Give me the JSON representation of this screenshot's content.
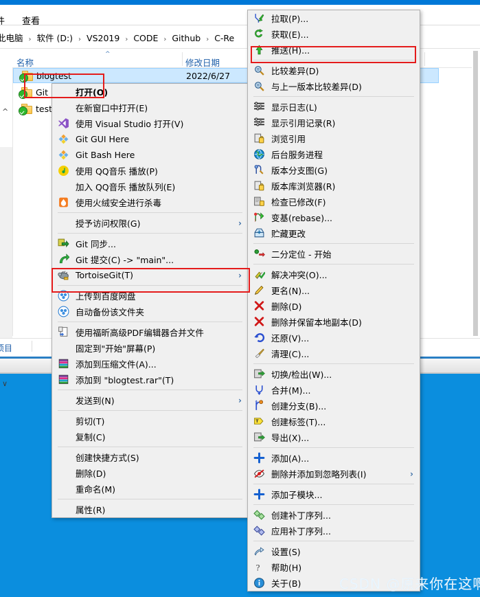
{
  "window": {
    "ribbon_tabs": [
      "件",
      "查看"
    ],
    "breadcrumb": [
      "此电脑",
      "软件 (D:)",
      "VS2019",
      "CODE",
      "Github",
      "C-Re"
    ],
    "breadcrumb_sep": "›",
    "columns": {
      "name": "名称",
      "date": "修改日期"
    },
    "status": "项目",
    "files": [
      {
        "name": "blogtest",
        "date": "2022/6/27",
        "icon": "folder-git-icon",
        "selected": true
      },
      {
        "name": "Git",
        "date": "",
        "icon": "folder-git-icon",
        "selected": false
      },
      {
        "name": "test",
        "date": "",
        "icon": "folder-git-icon",
        "selected": false
      }
    ]
  },
  "context_menu": {
    "name": "explorer-context-menu",
    "items": [
      {
        "label": "打开(O)",
        "icon": null,
        "bold": true,
        "type": "item"
      },
      {
        "label": "在新窗口中打开(E)",
        "icon": null,
        "type": "item"
      },
      {
        "label": "使用 Visual Studio 打开(V)",
        "icon": "visual-studio-icon",
        "type": "item"
      },
      {
        "label": "Git GUI Here",
        "icon": "git-gui-icon",
        "type": "item"
      },
      {
        "label": "Git Bash Here",
        "icon": "git-bash-icon",
        "type": "item"
      },
      {
        "label": "使用 QQ音乐 播放(P)",
        "icon": "qq-music-icon",
        "type": "item"
      },
      {
        "label": "加入 QQ音乐 播放队列(E)",
        "icon": null,
        "type": "item"
      },
      {
        "label": "使用火绒安全进行杀毒",
        "icon": "huorong-icon",
        "type": "item"
      },
      {
        "type": "separator"
      },
      {
        "label": "授予访问权限(G)",
        "icon": null,
        "submenu": true,
        "type": "item"
      },
      {
        "type": "separator"
      },
      {
        "label": "Git 同步...",
        "icon": "git-sync-icon",
        "type": "item"
      },
      {
        "label": "Git 提交(C) -> \"main\"...",
        "icon": "git-commit-icon",
        "type": "item"
      },
      {
        "label": "TortoiseGit(T)",
        "icon": "tortoisegit-icon",
        "submenu": true,
        "type": "item",
        "highlighted": true
      },
      {
        "type": "separator"
      },
      {
        "label": "上传到百度网盘",
        "icon": "baidu-netdisk-icon",
        "type": "item"
      },
      {
        "label": "自动备份该文件夹",
        "icon": "baidu-netdisk-icon",
        "type": "item"
      },
      {
        "type": "separator"
      },
      {
        "label": "使用福昕高级PDF编辑器合并文件",
        "icon": "foxit-pdf-icon",
        "type": "item"
      },
      {
        "label": "固定到\"开始\"屏幕(P)",
        "icon": null,
        "type": "item"
      },
      {
        "label": "添加到压缩文件(A)...",
        "icon": "winrar-icon",
        "type": "item"
      },
      {
        "label": "添加到 \"blogtest.rar\"(T)",
        "icon": "winrar-icon",
        "type": "item"
      },
      {
        "type": "separator"
      },
      {
        "label": "发送到(N)",
        "icon": null,
        "submenu": true,
        "type": "item"
      },
      {
        "type": "separator"
      },
      {
        "label": "剪切(T)",
        "icon": null,
        "type": "item"
      },
      {
        "label": "复制(C)",
        "icon": null,
        "type": "item"
      },
      {
        "type": "separator"
      },
      {
        "label": "创建快捷方式(S)",
        "icon": null,
        "type": "item"
      },
      {
        "label": "删除(D)",
        "icon": null,
        "type": "item"
      },
      {
        "label": "重命名(M)",
        "icon": null,
        "type": "item"
      },
      {
        "type": "separator"
      },
      {
        "label": "属性(R)",
        "icon": null,
        "type": "item"
      }
    ]
  },
  "submenu": {
    "name": "tortoisegit-submenu",
    "items": [
      {
        "label": "拉取(P)...",
        "icon": "pull-icon",
        "type": "item"
      },
      {
        "label": "获取(E)...",
        "icon": "fetch-icon",
        "type": "item"
      },
      {
        "label": "推送(H)...",
        "icon": "push-icon",
        "type": "item",
        "highlighted": true
      },
      {
        "type": "separator"
      },
      {
        "label": "比较差异(D)",
        "icon": "diff-icon",
        "type": "item"
      },
      {
        "label": "与上一版本比较差异(D)",
        "icon": "diff-icon",
        "type": "item"
      },
      {
        "type": "separator"
      },
      {
        "label": "显示日志(L)",
        "icon": "log-icon",
        "type": "item"
      },
      {
        "label": "显示引用记录(R)",
        "icon": "log-icon",
        "type": "item"
      },
      {
        "label": "浏览引用",
        "icon": "browse-ref-icon",
        "type": "item"
      },
      {
        "label": "后台服务进程",
        "icon": "daemon-icon",
        "type": "item"
      },
      {
        "label": "版本分支图(G)",
        "icon": "revision-graph-icon",
        "type": "item"
      },
      {
        "label": "版本库浏览器(R)",
        "icon": "repo-browser-icon",
        "type": "item"
      },
      {
        "label": "检查已修改(F)",
        "icon": "check-modifications-icon",
        "type": "item"
      },
      {
        "label": "变基(rebase)...",
        "icon": "rebase-icon",
        "type": "item"
      },
      {
        "label": "贮藏更改",
        "icon": "stash-icon",
        "type": "item"
      },
      {
        "type": "separator"
      },
      {
        "label": "二分定位 - 开始",
        "icon": "bisect-icon",
        "type": "item"
      },
      {
        "type": "separator"
      },
      {
        "label": "解决冲突(O)...",
        "icon": "resolve-icon",
        "type": "item"
      },
      {
        "label": "更名(N)...",
        "icon": "rename-icon",
        "type": "item"
      },
      {
        "label": "删除(D)",
        "icon": "delete-icon",
        "type": "item"
      },
      {
        "label": "删除并保留本地副本(D)",
        "icon": "delete-icon",
        "type": "item"
      },
      {
        "label": "还原(V)...",
        "icon": "revert-icon",
        "type": "item"
      },
      {
        "label": "清理(C)...",
        "icon": "cleanup-icon",
        "type": "item"
      },
      {
        "type": "separator"
      },
      {
        "label": "切换/检出(W)...",
        "icon": "switch-checkout-icon",
        "type": "item"
      },
      {
        "label": "合并(M)...",
        "icon": "merge-icon",
        "type": "item"
      },
      {
        "label": "创建分支(B)...",
        "icon": "create-branch-icon",
        "type": "item"
      },
      {
        "label": "创建标签(T)...",
        "icon": "create-tag-icon",
        "type": "item"
      },
      {
        "label": "导出(X)...",
        "icon": "export-icon",
        "type": "item"
      },
      {
        "type": "separator"
      },
      {
        "label": "添加(A)...",
        "icon": "add-icon",
        "type": "item"
      },
      {
        "label": "删除并添加到忽略列表(I)",
        "icon": "ignore-icon",
        "submenu": true,
        "type": "item"
      },
      {
        "type": "separator"
      },
      {
        "label": "添加子模块...",
        "icon": "add-icon",
        "type": "item"
      },
      {
        "type": "separator"
      },
      {
        "label": "创建补丁序列...",
        "icon": "create-patch-icon",
        "type": "item"
      },
      {
        "label": "应用补丁序列...",
        "icon": "apply-patch-icon",
        "type": "item"
      },
      {
        "type": "separator"
      },
      {
        "label": "设置(S)",
        "icon": "settings-icon",
        "type": "item"
      },
      {
        "label": "帮助(H)",
        "icon": "help-icon",
        "type": "item"
      },
      {
        "label": "关于(B)",
        "icon": "about-icon",
        "type": "item"
      }
    ]
  },
  "annotations": {
    "color": "#e41b1b",
    "boxes": [
      "file-blogtest",
      "tortoisegit-menu-item",
      "push-menu-item"
    ]
  },
  "watermark": {
    "text": "CSDN @原来你在这啊"
  }
}
